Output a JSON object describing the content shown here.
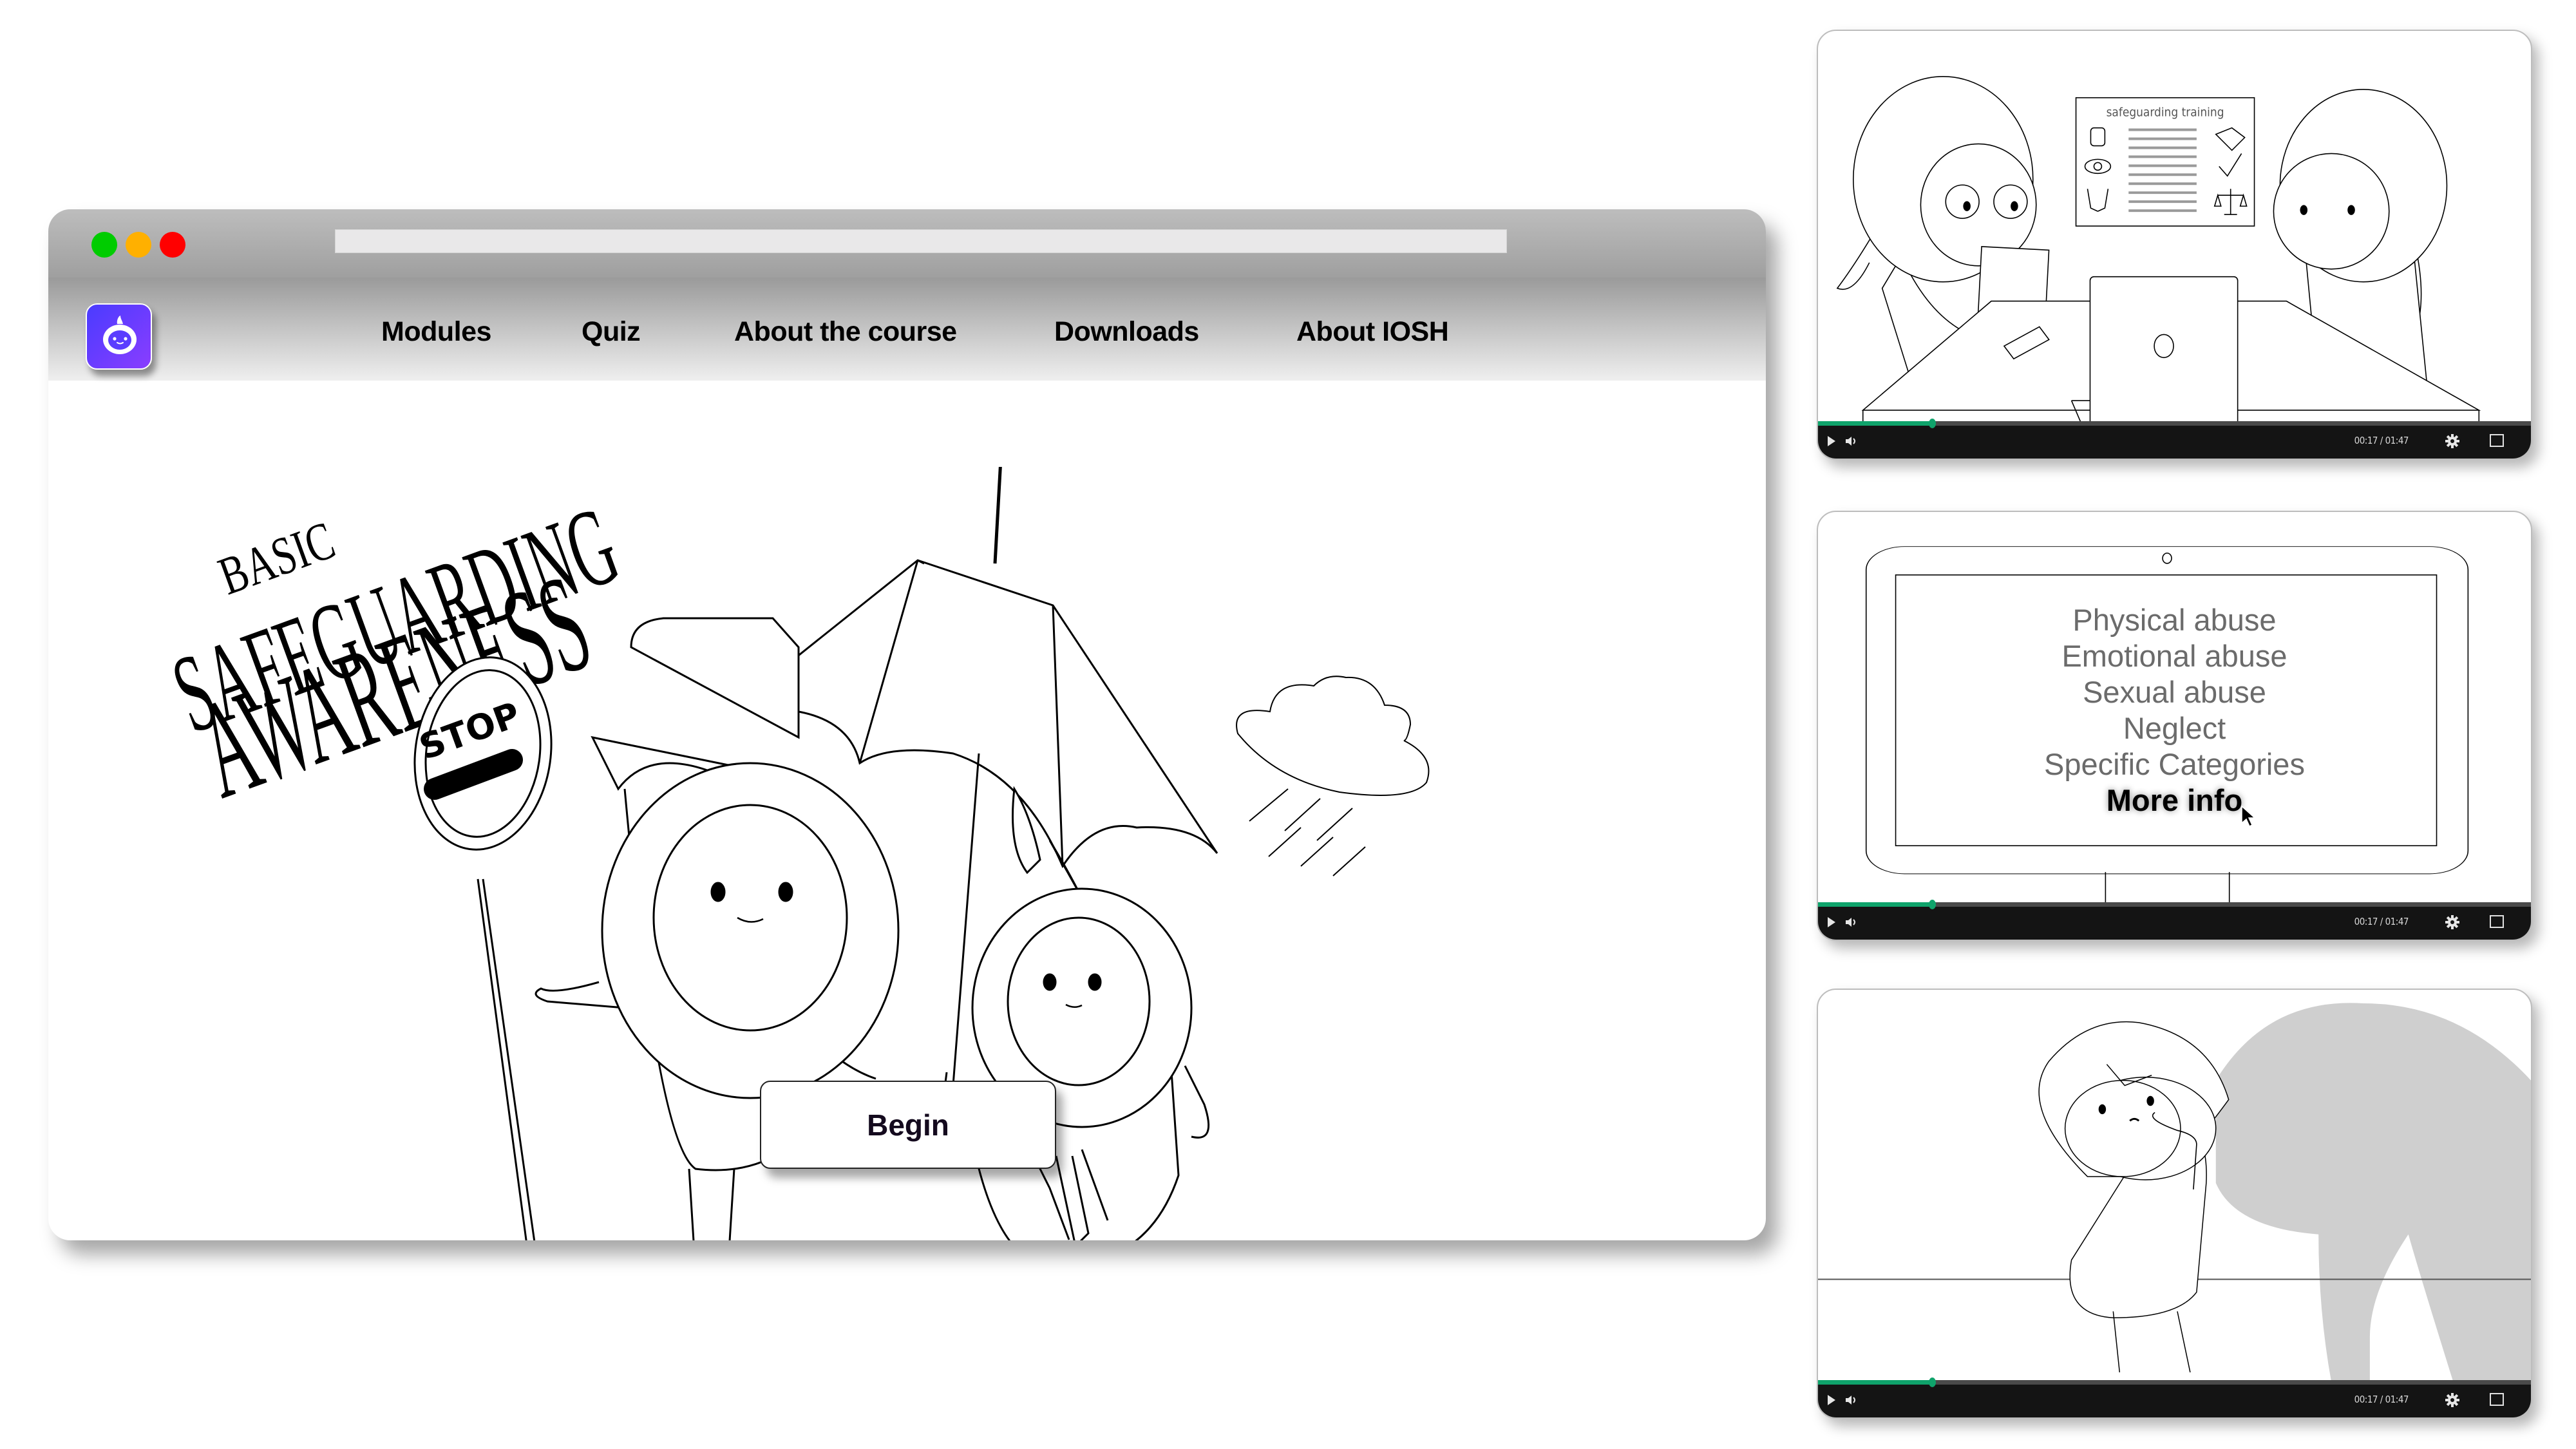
{
  "browser": {
    "window_controls": [
      "close",
      "minimize",
      "maximize"
    ],
    "colors": {
      "green": "#00cc00",
      "orange": "#ffb000",
      "red": "#ff0000"
    },
    "address_bar": ""
  },
  "nav": {
    "logo_icon": "character-face-icon",
    "items": [
      {
        "label": "Modules"
      },
      {
        "label": "Quiz"
      },
      {
        "label": "About the course"
      },
      {
        "label": "Downloads"
      },
      {
        "label": "About IOSH"
      }
    ]
  },
  "hero": {
    "title_line1": "BASIC",
    "title_line2": "SAFEGUARDING",
    "title_line3": "AWARENESS",
    "sign_text": "STOP",
    "begin_label": "Begin"
  },
  "videos": [
    {
      "scene": "two-colleagues-at-desk",
      "poster_title": "safeguarding training",
      "poster_icons": [
        "fist-icon",
        "eye-icon",
        "hands-icon",
        "handshake-icon",
        "checkmark-icon",
        "scales-icon"
      ],
      "time": "00:17 / 01:47",
      "progress": 0.16
    },
    {
      "scene": "monitor-menu",
      "menu": [
        "Physical abuse",
        "Emotional abuse",
        "Sexual abuse",
        "Neglect",
        "Specific Categories"
      ],
      "menu_highlight": "More info",
      "time": "00:17 / 01:47",
      "progress": 0.16
    },
    {
      "scene": "worried-character-with-shadow",
      "time": "00:17 / 01:47",
      "progress": 0.16
    }
  ],
  "colors": {
    "logo_gradient": [
      "#4a3cff",
      "#8a3dff"
    ],
    "progress": "#0fa36b",
    "player_bar": "#141414"
  }
}
